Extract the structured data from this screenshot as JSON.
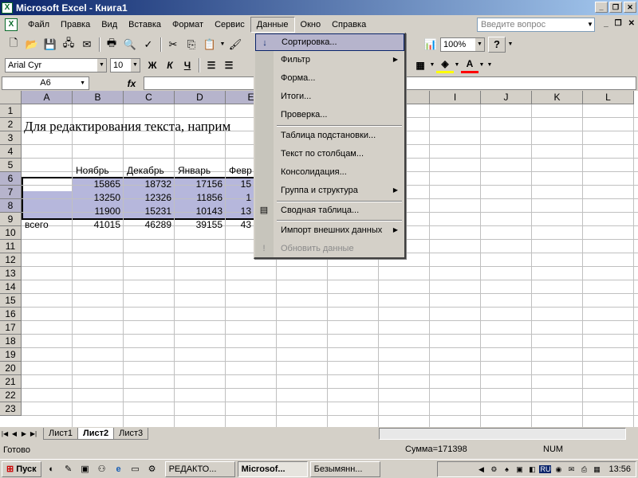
{
  "window": {
    "title": "Microsoft Excel - Книга1"
  },
  "menu": {
    "items": [
      "Файл",
      "Правка",
      "Вид",
      "Вставка",
      "Формат",
      "Сервис",
      "Данные",
      "Окно",
      "Справка"
    ],
    "active": "Данные",
    "help_placeholder": "Введите вопрос"
  },
  "toolbar": {
    "zoom": "100%",
    "font": "Arial Cyr",
    "size": "10",
    "bold": "Ж",
    "italic": "К",
    "underline": "Ч"
  },
  "formula_bar": {
    "name_box": "A6",
    "fx": "fx",
    "value": ""
  },
  "grid": {
    "columns": [
      "A",
      "B",
      "C",
      "D",
      "E",
      "F",
      "G",
      "H",
      "I",
      "J",
      "K",
      "L"
    ],
    "rows": [
      "1",
      "2",
      "3",
      "4",
      "5",
      "6",
      "7",
      "8",
      "9",
      "10",
      "11",
      "12",
      "13",
      "14",
      "15",
      "16",
      "17",
      "18",
      "19",
      "20",
      "21",
      "22",
      "23"
    ],
    "title_cell": "Для редактирования текста, наприм",
    "header_row": [
      "Ноябрь",
      "Декабрь",
      "Январь",
      "Февр"
    ],
    "data_rows": [
      [
        "",
        "15865",
        "18732",
        "17156",
        "15"
      ],
      [
        "",
        "13250",
        "12326",
        "11856",
        "1"
      ],
      [
        "",
        "11900",
        "15231",
        "10143",
        "13"
      ]
    ],
    "total_row": [
      "всего",
      "41015",
      "46289",
      "39155",
      "43"
    ]
  },
  "data_menu": {
    "items": [
      {
        "label": "Сортировка...",
        "submenu": false,
        "highlighted": true,
        "icon": "sort-icon"
      },
      {
        "label": "Фильтр",
        "submenu": true
      },
      {
        "label": "Форма...",
        "submenu": false
      },
      {
        "label": "Итоги...",
        "submenu": false
      },
      {
        "label": "Проверка...",
        "submenu": false
      },
      {
        "label": "Таблица подстановки...",
        "submenu": false
      },
      {
        "label": "Текст по столбцам...",
        "submenu": false
      },
      {
        "label": "Консолидация...",
        "submenu": false
      },
      {
        "label": "Группа и структура",
        "submenu": true
      },
      {
        "label": "Сводная таблица...",
        "submenu": false,
        "icon": "pivot-table-icon"
      },
      {
        "label": "Импорт внешних данных",
        "submenu": true
      },
      {
        "label": "Обновить данные",
        "submenu": false,
        "disabled": true,
        "icon": "refresh-icon"
      }
    ]
  },
  "sheets": {
    "tabs": [
      "Лист1",
      "Лист2",
      "Лист3"
    ],
    "active": "Лист2"
  },
  "status": {
    "ready": "Готово",
    "sum": "Сумма=171398",
    "num": "NUM"
  },
  "taskbar": {
    "start": "Пуск",
    "tasks": [
      "РЕДАКТО...",
      "Microsof...",
      "Безымянн..."
    ],
    "active_task": "Microsof...",
    "lang": "RU",
    "clock": "13:56"
  },
  "colors": {
    "title_gradient_start": "#0a246a",
    "selection": "#b6b7dc",
    "menu_highlight": "#b6b4cc"
  }
}
